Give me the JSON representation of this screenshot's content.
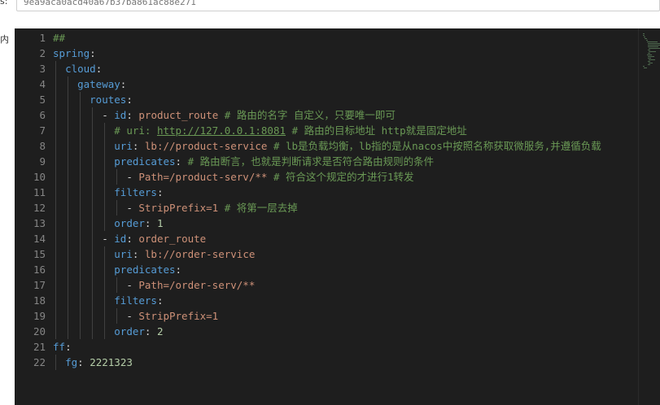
{
  "top": {
    "label": "s:",
    "id_value": "9ea9aca0acd40a67b37ba861ac88e271",
    "side_glyph": "内"
  },
  "editor": {
    "lines": [
      [
        {
          "t": "##",
          "c": "c"
        }
      ],
      [
        {
          "t": "spring",
          "c": "k"
        },
        {
          "t": ":",
          "c": "p"
        }
      ],
      [
        {
          "t": "  "
        },
        {
          "t": "cloud",
          "c": "k"
        },
        {
          "t": ":",
          "c": "p"
        }
      ],
      [
        {
          "t": "    "
        },
        {
          "t": "gateway",
          "c": "k"
        },
        {
          "t": ":",
          "c": "p"
        }
      ],
      [
        {
          "t": "      "
        },
        {
          "t": "routes",
          "c": "k"
        },
        {
          "t": ":",
          "c": "p"
        }
      ],
      [
        {
          "t": "        "
        },
        {
          "t": "- ",
          "c": "p"
        },
        {
          "t": "id",
          "c": "k"
        },
        {
          "t": ": ",
          "c": "p"
        },
        {
          "t": "product_route",
          "c": "s"
        },
        {
          "t": " # 路由的名字 自定义，只要唯一即可",
          "c": "c"
        }
      ],
      [
        {
          "t": "          "
        },
        {
          "t": "# uri: ",
          "c": "c"
        },
        {
          "t": "http://127.0.0.1:8081",
          "c": "u"
        },
        {
          "t": " # 路由的目标地址 http就是固定地址",
          "c": "c"
        }
      ],
      [
        {
          "t": "          "
        },
        {
          "t": "uri",
          "c": "k"
        },
        {
          "t": ": ",
          "c": "p"
        },
        {
          "t": "lb://product-service",
          "c": "s"
        },
        {
          "t": " # lb是负载均衡，lb指的是从nacos中按照名称获取微服务,并遵循负载",
          "c": "c"
        }
      ],
      [
        {
          "t": "          "
        },
        {
          "t": "predicates",
          "c": "k"
        },
        {
          "t": ":",
          "c": "p"
        },
        {
          "t": " # 路由断言，也就是判断请求是否符合路由规则的条件",
          "c": "c"
        }
      ],
      [
        {
          "t": "            "
        },
        {
          "t": "- ",
          "c": "p"
        },
        {
          "t": "Path=/product-serv/**",
          "c": "s"
        },
        {
          "t": " # 符合这个规定的才进行1转发",
          "c": "c"
        }
      ],
      [
        {
          "t": "          "
        },
        {
          "t": "filters",
          "c": "k"
        },
        {
          "t": ":",
          "c": "p"
        }
      ],
      [
        {
          "t": "            "
        },
        {
          "t": "- ",
          "c": "p"
        },
        {
          "t": "StripPrefix=1",
          "c": "s"
        },
        {
          "t": " # 将第一层去掉",
          "c": "c"
        }
      ],
      [
        {
          "t": "          "
        },
        {
          "t": "order",
          "c": "k"
        },
        {
          "t": ": ",
          "c": "p"
        },
        {
          "t": "1",
          "c": "n"
        }
      ],
      [
        {
          "t": "        "
        },
        {
          "t": "- ",
          "c": "p"
        },
        {
          "t": "id",
          "c": "k"
        },
        {
          "t": ": ",
          "c": "p"
        },
        {
          "t": "order_route",
          "c": "s"
        }
      ],
      [
        {
          "t": "          "
        },
        {
          "t": "uri",
          "c": "k"
        },
        {
          "t": ": ",
          "c": "p"
        },
        {
          "t": "lb://order-service",
          "c": "s"
        }
      ],
      [
        {
          "t": "          "
        },
        {
          "t": "predicates",
          "c": "k"
        },
        {
          "t": ":",
          "c": "p"
        }
      ],
      [
        {
          "t": "            "
        },
        {
          "t": "- ",
          "c": "p"
        },
        {
          "t": "Path=/order-serv/**",
          "c": "s"
        }
      ],
      [
        {
          "t": "          "
        },
        {
          "t": "filters",
          "c": "k"
        },
        {
          "t": ":",
          "c": "p"
        }
      ],
      [
        {
          "t": "            "
        },
        {
          "t": "- ",
          "c": "p"
        },
        {
          "t": "StripPrefix=1",
          "c": "s"
        }
      ],
      [
        {
          "t": "          "
        },
        {
          "t": "order",
          "c": "k"
        },
        {
          "t": ": ",
          "c": "p"
        },
        {
          "t": "2",
          "c": "n"
        }
      ],
      [
        {
          "t": "ff",
          "c": "k"
        },
        {
          "t": ":",
          "c": "p"
        }
      ],
      [
        {
          "t": "  "
        },
        {
          "t": "fg",
          "c": "k"
        },
        {
          "t": ": ",
          "c": "p"
        },
        {
          "t": "2221323",
          "c": "n"
        }
      ]
    ]
  }
}
